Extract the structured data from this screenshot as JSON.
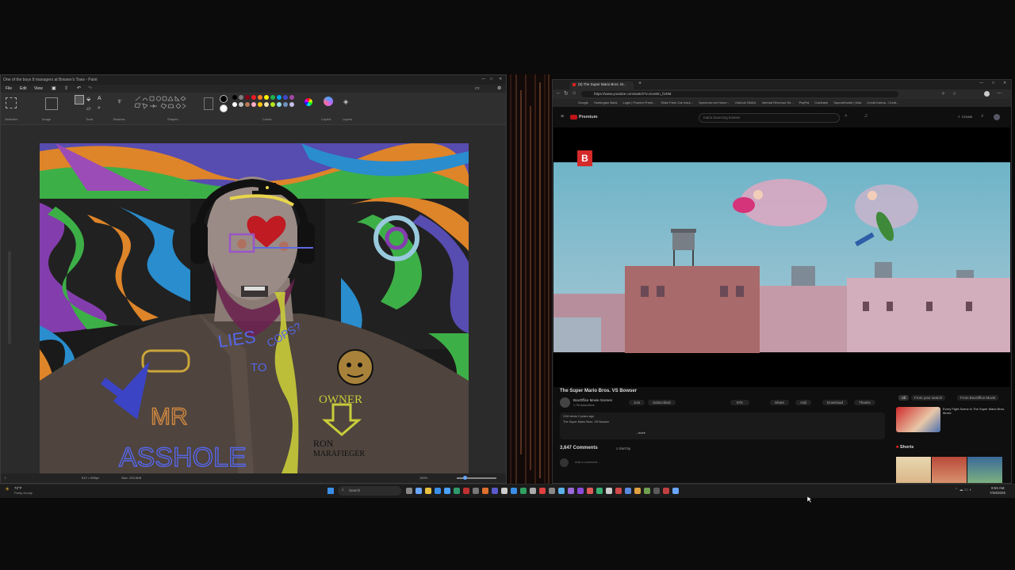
{
  "paint": {
    "title": "One of the boys 8 managers at Bowser's Tows - Paint",
    "menu": [
      "File",
      "Edit",
      "View"
    ],
    "groups": [
      "Selection",
      "Image",
      "Tools",
      "Brushes",
      "Shapes",
      "Colors",
      "Copilot",
      "Layers"
    ],
    "palette": [
      "#000000",
      "#7f7f7f",
      "#880015",
      "#ed1c24",
      "#ff7f27",
      "#fff200",
      "#22b14c",
      "#00a2e8",
      "#3f48cc",
      "#a349a4",
      "#ffffff",
      "#c3c3c3",
      "#b97a57",
      "#ffaec9",
      "#ffc90e",
      "#efe4b0",
      "#b5e61d",
      "#99d9ea",
      "#7092be",
      "#c8bfe7"
    ],
    "status": {
      "dimensions": "912 × 895px",
      "size": "Size: 234.6KB",
      "zoom": "150%"
    },
    "drawing": {
      "text_lies": "LIES",
      "text_to": "TO",
      "text_cops": "COPS?",
      "text_owner": "OWNER",
      "text_mr": "MR",
      "text_name": "RON",
      "text_name2": "MARAFIEGER",
      "text_bottom": "ASSHOLE"
    }
  },
  "browser": {
    "tab_title": "(5) The Super Mario Bros. M...",
    "url": "https://www.youtube.com/watch?v=kvo8m_f10IM",
    "bookmarks": [
      "Google",
      "Huntington Bank",
      "Login | Powers Fresh...",
      "State Farm Car Insur...",
      "Spectrum.net Home...",
      "Outlook SMAIL",
      "Internal Revenue Se...",
      "PayPal",
      "Coinbase",
      "SqueaKfootie | Kids",
      "Credit Karma - Credi..."
    ],
    "youtube": {
      "logo": "Premium",
      "search_placeholder": "mario bouncing bowser",
      "channel_badge": "B",
      "video_title": "The Super Mario Bros. VS Bowser",
      "channel_name": "BoxOffice Movie Scenes",
      "channel_subs": "1.7M subscribers",
      "join": "Join",
      "subscribed": "Subscribed",
      "like_count": "87K",
      "share": "Share",
      "add": "Add",
      "download": "Download",
      "thanks": "Thanks",
      "views": "21M views  2 years ago",
      "desc_line": "The Super Mario Bros. VS Bowser",
      "desc_more": "...more",
      "comments": "3,647 Comments",
      "sort_by": "Sort by",
      "add_comment": "Add a comment...",
      "filter_all": "All",
      "filter_search": "From your search",
      "filter_channel": "From BoxOffice Movie",
      "rec_title": "Every Fight Scene in The Super Mario Bros. Movie",
      "shorts": "Shorts"
    }
  },
  "taskbar": {
    "temperature": "72°F",
    "weather": "Partly cloudy",
    "search": "Search",
    "time": "9:53 AM",
    "date": "7/28/2025"
  }
}
